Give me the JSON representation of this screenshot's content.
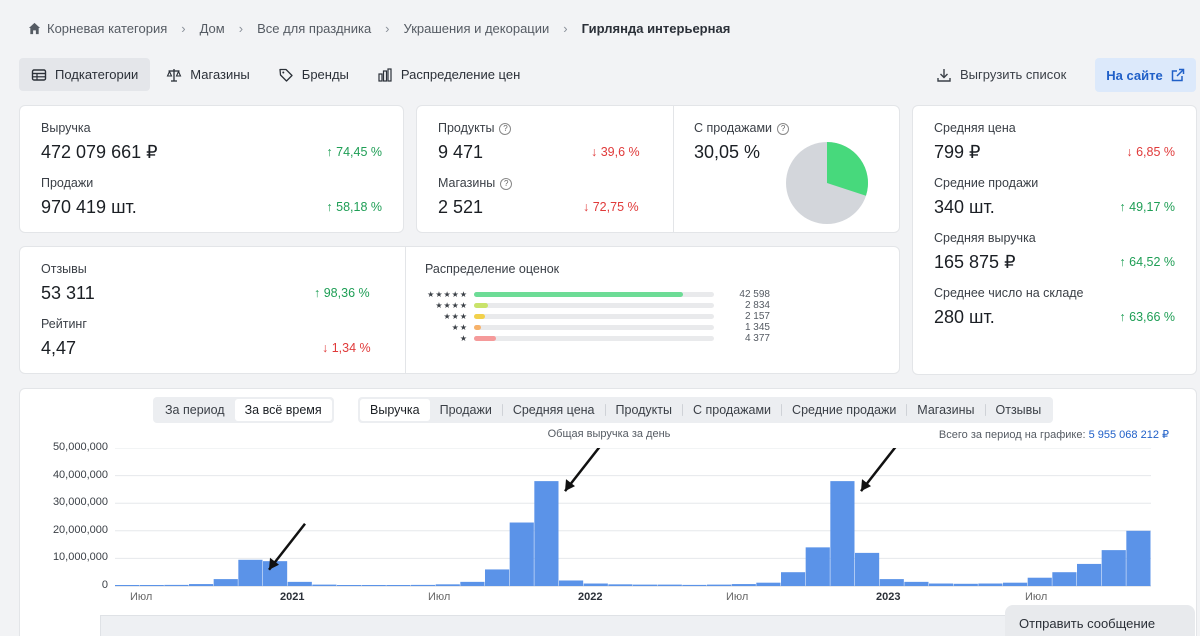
{
  "breadcrumb": [
    "Корневая категория",
    "Дом",
    "Все для праздника",
    "Украшения и декорации",
    "Гирлянда интерьерная"
  ],
  "tabs": [
    "Подкатегории",
    "Магазины",
    "Бренды",
    "Распределение цен"
  ],
  "actions": {
    "export": "Выгрузить список",
    "onsite": "На сайте"
  },
  "metrics": {
    "revenue": {
      "label": "Выручка",
      "value": "472 079 661 ₽",
      "change": "74,45 %"
    },
    "sales": {
      "label": "Продажи",
      "value": "970 419 шт.",
      "change": "58,18 %"
    },
    "products": {
      "label": "Продукты",
      "value": "9 471",
      "change": "39,6 %"
    },
    "shops": {
      "label": "Магазины",
      "value": "2 521",
      "change": "72,75 %"
    },
    "with_sales": {
      "label": "С продажами",
      "value": "30,05 %",
      "share": 0.3005
    },
    "reviews": {
      "label": "Отзывы",
      "value": "53 311",
      "change": "98,36 %"
    },
    "rating": {
      "label": "Рейтинг",
      "value": "4,47",
      "change": "1,34 %"
    },
    "avg_price": {
      "label": "Средняя цена",
      "value": "799 ₽",
      "change": "6,85 %"
    },
    "avg_sales": {
      "label": "Средние продажи",
      "value": "340 шт.",
      "change": "49,17 %"
    },
    "avg_revenue": {
      "label": "Средняя выручка",
      "value": "165 875 ₽",
      "change": "64,52 %"
    },
    "avg_stock": {
      "label": "Среднее число на складе",
      "value": "280 шт.",
      "change": "63,66 %"
    }
  },
  "ratings": {
    "title": "Распределение оценок",
    "rows": [
      {
        "stars": "★★★★★",
        "count": "42 598",
        "share": 0.87,
        "color": "#6ddc96"
      },
      {
        "stars": "★★★★",
        "count": "2 834",
        "share": 0.058,
        "color": "#c9e36a"
      },
      {
        "stars": "★★★",
        "count": "2 157",
        "share": 0.044,
        "color": "#f2d14b"
      },
      {
        "stars": "★★",
        "count": "1 345",
        "share": 0.028,
        "color": "#f7b26a"
      },
      {
        "stars": "★",
        "count": "4 377",
        "share": 0.09,
        "color": "#f59a9a"
      }
    ]
  },
  "period_toggle": [
    "За период",
    "За всё время"
  ],
  "metric_toggle": [
    "Выручка",
    "Продажи",
    "Средняя цена",
    "Продукты",
    "С продажами",
    "Средние продажи",
    "Магазины",
    "Отзывы"
  ],
  "chart_data": {
    "type": "area",
    "title": "Общая выручка за день",
    "total_label": "Всего за период на графике:",
    "total_value": "5 955 068 212 ₽",
    "ylim": [
      0,
      50000000
    ],
    "yticks": [
      "50,000,000",
      "40,000,000",
      "30,000,000",
      "20,000,000",
      "10,000,000",
      "0"
    ],
    "xticks": [
      "Июл",
      "2021",
      "Июл",
      "2022",
      "Июл",
      "2023",
      "Июл"
    ],
    "x": [
      "2020-07",
      "2020-08",
      "2020-09",
      "2020-10",
      "2020-11",
      "2020-12",
      "2021-01",
      "2021-02",
      "2021-03",
      "2021-04",
      "2021-05",
      "2021-06",
      "2021-07",
      "2021-08",
      "2021-09",
      "2021-10",
      "2021-11",
      "2021-12",
      "2022-01",
      "2022-02",
      "2022-03",
      "2022-04",
      "2022-05",
      "2022-06",
      "2022-07",
      "2022-08",
      "2022-09",
      "2022-10",
      "2022-11",
      "2022-12",
      "2023-01",
      "2023-02",
      "2023-03",
      "2023-04",
      "2023-05",
      "2023-06",
      "2023-07",
      "2023-08",
      "2023-09",
      "2023-10",
      "2023-11",
      "2023-12"
    ],
    "values": [
      200000,
      300000,
      400000,
      700000,
      2500000,
      9500000,
      9000000,
      1500000,
      500000,
      300000,
      300000,
      300000,
      400000,
      600000,
      1500000,
      6000000,
      23000000,
      38000000,
      2000000,
      900000,
      600000,
      500000,
      500000,
      400000,
      500000,
      700000,
      1200000,
      5000000,
      14000000,
      38000000,
      12000000,
      2500000,
      1500000,
      900000,
      800000,
      900000,
      1200000,
      3000000,
      5000000,
      8000000,
      13000000,
      20000000
    ],
    "grid": true
  },
  "send_message": "Отправить сообщение"
}
